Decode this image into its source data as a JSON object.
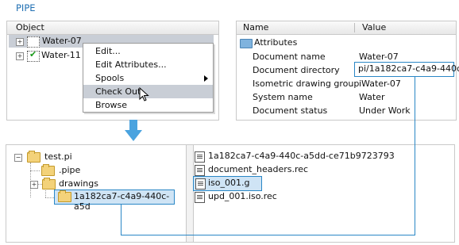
{
  "pipe_panel": {
    "title": "PIPE",
    "column_header": "Object",
    "items": [
      {
        "label": "Water-07"
      },
      {
        "label": "Water-11"
      }
    ]
  },
  "context_menu": {
    "items": [
      {
        "label": "Edit...",
        "submenu": false
      },
      {
        "label": "Edit Attributes...",
        "submenu": false
      },
      {
        "label": "Spools",
        "submenu": true
      },
      {
        "label": "Check Out",
        "submenu": false,
        "highlighted": true
      },
      {
        "label": "Browse",
        "submenu": false
      }
    ]
  },
  "attributes_panel": {
    "columns": {
      "name": "Name",
      "value": "Value"
    },
    "root_label": "Attributes",
    "rows": [
      {
        "name": "Document name",
        "value": "Water-07"
      },
      {
        "name": "Document directory",
        "value": "pi/1a182ca7-c4a9-440c"
      },
      {
        "name": "Isometric drawing group",
        "value": "iWater-07"
      },
      {
        "name": "System name",
        "value": "Water"
      },
      {
        "name": "Document status",
        "value": "Under Work"
      }
    ]
  },
  "file_browser": {
    "tree": [
      {
        "label": "test.pi"
      },
      {
        "label": ".pipe"
      },
      {
        "label": "drawings"
      },
      {
        "label": "1a182ca7-c4a9-440c-a5d"
      }
    ],
    "files": [
      {
        "label": "1a182ca7-c4a9-440c-a5dd-ce71b9723793"
      },
      {
        "label": "document_headers.rec"
      },
      {
        "label": "iso_001.g"
      },
      {
        "label": "upd_001.iso.rec"
      }
    ]
  },
  "colors": {
    "accent": "#2a87c6",
    "title": "#1f6fb3",
    "selection": "#c9ced6"
  }
}
